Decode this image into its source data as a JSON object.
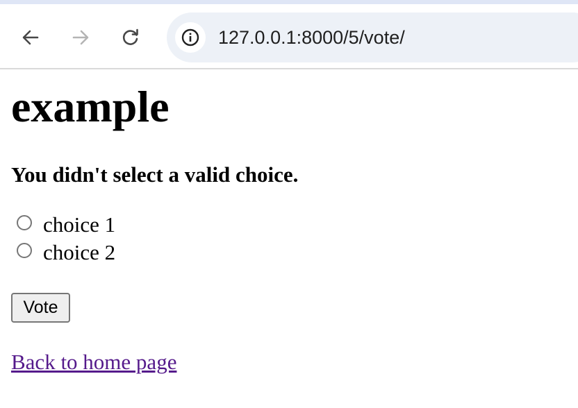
{
  "browser": {
    "back_icon": "arrow-left-icon",
    "forward_icon": "arrow-right-icon",
    "reload_icon": "reload-icon",
    "site_info_icon": "info-icon",
    "url": "127.0.0.1:8000/5/vote/",
    "colors": {
      "omnibox_bg": "#edf1f7",
      "top_strip": "#dfe6f6",
      "forward_disabled": "#b4b4b4"
    }
  },
  "page": {
    "title": "example",
    "error_message": "You didn't select a valid choice.",
    "choices": [
      {
        "label": "choice 1",
        "selected": false
      },
      {
        "label": "choice 2",
        "selected": false
      }
    ],
    "vote_button": "Vote",
    "back_link": "Back to home page",
    "colors": {
      "link_visited": "#551a8b"
    }
  }
}
